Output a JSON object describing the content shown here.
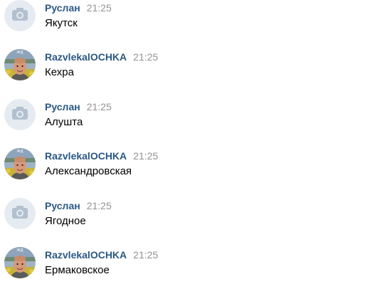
{
  "messages": [
    {
      "author": "Руслан",
      "time": "21:25",
      "text": "Якутск",
      "avatar": "camera-placeholder-icon"
    },
    {
      "author": "RazvlekalOCHKA",
      "time": "21:25",
      "text": "Кехра",
      "avatar": "user-photo"
    },
    {
      "author": "Руслан",
      "time": "21:25",
      "text": "Алушта",
      "avatar": "camera-placeholder-icon"
    },
    {
      "author": "RazvlekalOCHKA",
      "time": "21:25",
      "text": "Александровская",
      "avatar": "user-photo"
    },
    {
      "author": "Руслан",
      "time": "21:25",
      "text": "Ягодное",
      "avatar": "camera-placeholder-icon"
    },
    {
      "author": "RazvlekalOCHKA",
      "time": "21:25",
      "text": "Ермаковское",
      "avatar": "user-photo"
    }
  ],
  "colors": {
    "author": "#2a5885",
    "time": "#939393",
    "text": "#000000",
    "placeholder_bg": "#e5ebf1",
    "placeholder_icon": "#b2c0cf"
  }
}
